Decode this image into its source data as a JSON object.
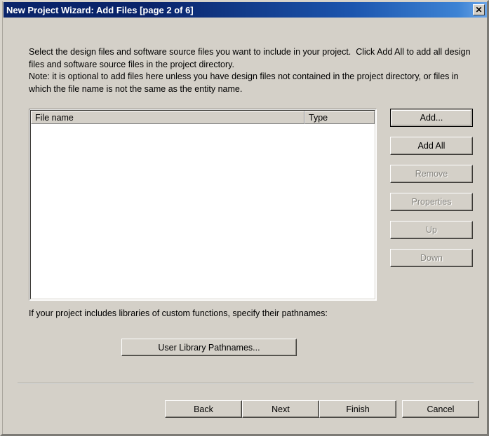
{
  "window": {
    "title": "New Project Wizard: Add Files [page 2 of 6]",
    "close_label": "✕",
    "bg_color": "#d4d0c8",
    "titlebar_color": "#0a246a"
  },
  "description": "Select the design files and software source files you want to include in your project.  Click Add All to add all design files and software source files in the project directory.\nNote: it is optional to add files here unless you have design files not contained in the project directory, or files in which the file name is not the same as the entity name.",
  "file_list": {
    "columns": [
      {
        "label": "File name"
      },
      {
        "label": "Type"
      }
    ],
    "rows": []
  },
  "side_buttons": [
    {
      "label": "Add...",
      "enabled": true,
      "default": true
    },
    {
      "label": "Add All",
      "enabled": true,
      "default": false
    },
    {
      "label": "Remove",
      "enabled": false,
      "default": false
    },
    {
      "label": "Properties",
      "enabled": false,
      "default": false
    },
    {
      "label": "Up",
      "enabled": false,
      "default": false
    },
    {
      "label": "Down",
      "enabled": false,
      "default": false
    }
  ],
  "library": {
    "text": "If your project includes libraries of custom functions, specify their pathnames:",
    "button_label": "User Library Pathnames..."
  },
  "bottom_buttons": {
    "back": "Back",
    "next": "Next",
    "finish": "Finish",
    "cancel": "Cancel"
  }
}
